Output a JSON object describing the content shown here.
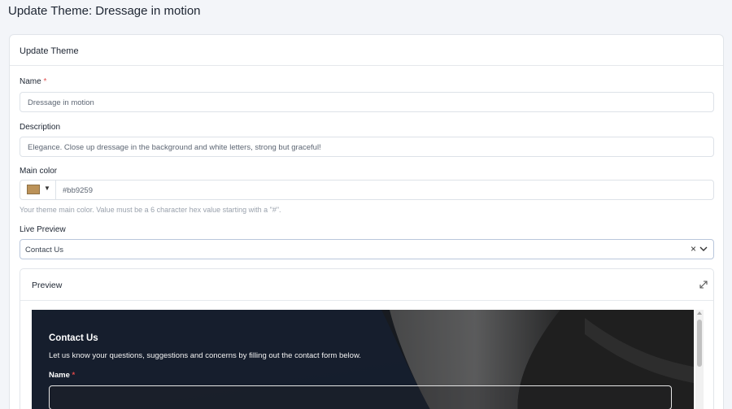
{
  "page": {
    "title": "Update Theme: Dressage in motion"
  },
  "card": {
    "header": "Update Theme"
  },
  "form": {
    "name": {
      "label": "Name",
      "required_mark": "*",
      "value": "Dressage in motion"
    },
    "description": {
      "label": "Description",
      "value": "Elegance. Close up dressage in the background and white letters, strong but graceful!"
    },
    "main_color": {
      "label": "Main color",
      "value": "#bb9259",
      "swatch_color": "#bb9259",
      "picker_caret": "▼",
      "hint": "Your theme main color. Value must be a 6 character hex value starting with a \"#\"."
    },
    "live_preview": {
      "label": "Live Preview",
      "selected": "Contact Us",
      "clear_symbol": "×"
    }
  },
  "preview": {
    "header": "Preview",
    "content": {
      "title": "Contact Us",
      "description": "Let us know your questions, suggestions and concerns by filling out the contact form below.",
      "name_label": "Name",
      "required_mark": "*"
    }
  },
  "colors": {
    "accent": "#bb9259",
    "required": "#e15454",
    "page_bg": "#f3f5f9",
    "preview_bg": "#2b2b2c"
  },
  "icons": [
    "chevron-down-icon",
    "close-icon",
    "expand-icon",
    "caret-down-icon"
  ]
}
